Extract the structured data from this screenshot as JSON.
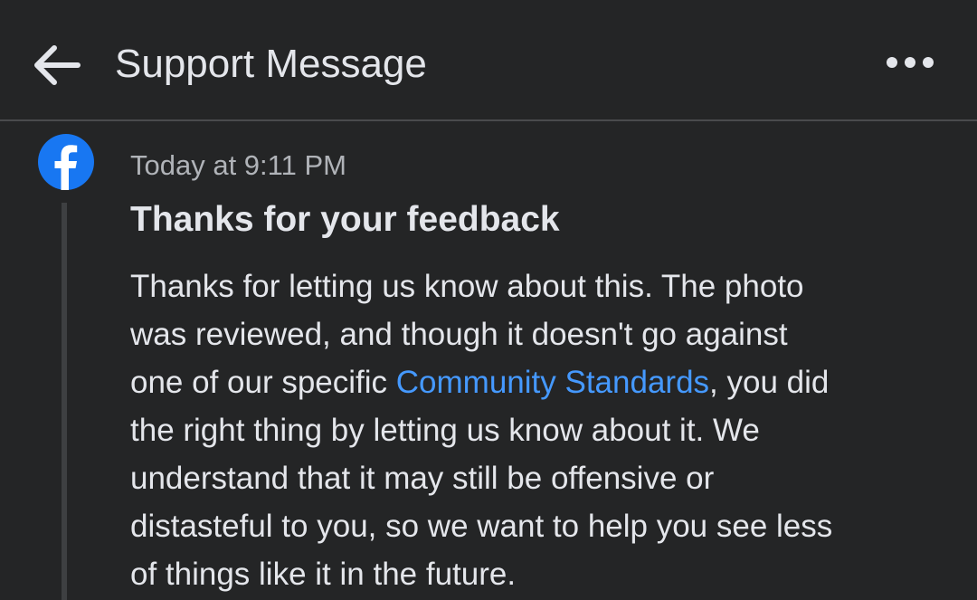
{
  "header": {
    "title": "Support Message",
    "back_icon": "arrow-left-icon",
    "more_icon": "more-horizontal-icon"
  },
  "message": {
    "sender_avatar": "facebook-logo-icon",
    "timestamp": "Today at 9:11 PM",
    "title": "Thanks for your feedback",
    "body": {
      "line1": "Thanks for letting us know about this. The photo",
      "line2": "was reviewed, and though it doesn't go against",
      "line3_pre": "one of our specific ",
      "line3_link": "Community Standards",
      "line3_post": ", you did",
      "line4": "the right thing by letting us know about it. We",
      "line5": "understand that it may still be offensive or",
      "line6": "distasteful to you, so we want to help you see less",
      "line7": "of things like it in the future."
    }
  },
  "colors": {
    "background": "#242526",
    "text": "#e4e6eb",
    "secondary_text": "#b0b3b8",
    "link": "#4599ff",
    "facebook_blue": "#1877f2"
  }
}
